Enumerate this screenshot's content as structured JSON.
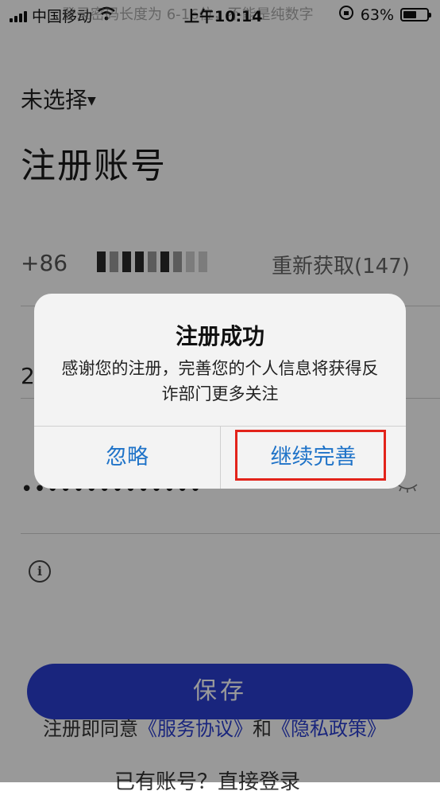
{
  "status_bar": {
    "carrier": "中国移动",
    "time": "上午10:14",
    "battery": "63%",
    "battery_level": 0.63,
    "hint": "登录密码长度为 6-16位，不能是纯数字"
  },
  "form": {
    "region": "未选择",
    "title": "注册账号",
    "country_code": "+86",
    "resend": "重新获取(147)",
    "code_first_char": "2",
    "password_mask": "••••••••••••••",
    "save_label": "保存",
    "agree_prefix": "注册即同意",
    "service_link": "《服务协议》",
    "and": "和",
    "privacy_link": "《隐私政策》",
    "login_text": "已有账号？直接登录"
  },
  "dialog": {
    "title": "注册成功",
    "message": "感谢您的注册，完善您的个人信息将获得反诈部门更多关注",
    "ignore_label": "忽略",
    "continue_label": "继续完善",
    "highlight_color": "#e2231a",
    "button_color": "#1f73c8"
  },
  "icons": [
    "signal-icon",
    "wifi-icon",
    "lock-rotation-icon",
    "battery-icon",
    "dropdown-caret-icon",
    "eye-icon",
    "info-icon"
  ]
}
